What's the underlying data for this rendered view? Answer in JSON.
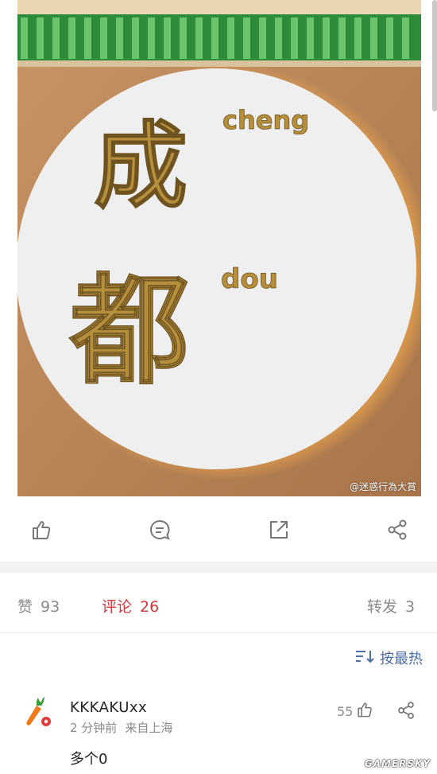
{
  "photo": {
    "sign_char_1": "成",
    "sign_pinyin_1": "cheng",
    "sign_char_2": "都",
    "sign_pinyin_2": "dou",
    "watermark": "@迷惑行為大賞"
  },
  "actions": [
    "like-icon",
    "comment-icon",
    "repost-icon",
    "share-icon"
  ],
  "stats": {
    "likes_label": "赞",
    "likes_count": "93",
    "comments_label": "评论",
    "comments_count": "26",
    "reposts_label": "转发",
    "reposts_count": "3"
  },
  "sort": {
    "label": "按最热"
  },
  "comment": {
    "username": "KKKAKUxx",
    "time": "2 分钟前",
    "location": "来自上海",
    "text": "多个0",
    "likes": "55"
  },
  "site_logo": "GAMERSKY",
  "colors": {
    "accent_red": "#d4373d",
    "link_blue": "#4b6ea8",
    "muted": "#8a8a8a",
    "sign_gold": "#b58f3c"
  }
}
